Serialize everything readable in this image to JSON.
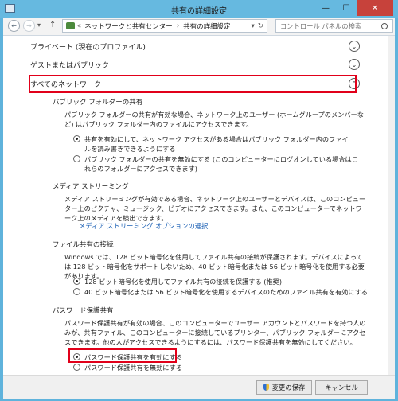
{
  "window": {
    "title": "共有の詳細設定",
    "min_symbol": "—",
    "max_symbol": "☐",
    "close_symbol": "✕"
  },
  "nav": {
    "back": "←",
    "forward": "→",
    "dropdown": "▾",
    "up": "↑",
    "breadcrumb_prefix": "«",
    "breadcrumb_1": "ネットワークと共有センター",
    "sep": "›",
    "breadcrumb_2": "共有の詳細設定",
    "addr_dropdown": "▾",
    "refresh": "↻",
    "search_placeholder": "コントロール パネルの検索"
  },
  "sections": {
    "private": {
      "label": "プライベート (現在のプロファイル)"
    },
    "guest": {
      "label": "ゲストまたはパブリック"
    },
    "all": {
      "label": "すべてのネットワーク"
    }
  },
  "public_folder": {
    "heading": "パブリック フォルダーの共有",
    "desc": "パブリック フォルダーの共有が有効な場合、ネットワーク上のユーザー (ホームグループのメンバーなど) はパブリック フォルダー内のファイルにアクセスできます。",
    "opt_on": "共有を有効にして、ネットワーク アクセスがある場合はパブリック フォルダー内のファイルを読み書きできるようにする",
    "opt_off": "パブリック フォルダーの共有を無効にする (このコンピューターにログオンしている場合はこれらのフォルダーにアクセスできます)"
  },
  "media": {
    "heading": "メディア ストリーミング",
    "desc": "メディア ストリーミングが有効である場合、ネットワーク上のユーザーとデバイスは、このコンピューター上のピクチャ、ミュージック、ビデオにアクセスできます。また、このコンピューターでネットワーク上のメディアを検出できます。",
    "link": "メディア ストリーミング オプションの選択..."
  },
  "file_sharing": {
    "heading": "ファイル共有の接続",
    "desc": "Windows では、128 ビット暗号化を使用してファイル共有の接続が保護されます。デバイスによっては 128 ビット暗号化をサポートしないため、40 ビット暗号化または 56 ビット暗号化を使用する必要があります。",
    "opt_128": "128 ビット暗号化を使用してファイル共有の接続を保護する (推奨)",
    "opt_40": "40 ビット暗号化または 56 ビット暗号化を使用するデバイスのためのファイル共有を有効にする"
  },
  "password": {
    "heading": "パスワード保護共有",
    "desc": "パスワード保護共有が有効の場合、このコンピューターでユーザー アカウントとパスワードを持つ人のみが、共有ファイル、このコンピューターに接続しているプリンター、パブリック フォルダーにアクセスできます。他の人がアクセスできるようにするには、パスワード保護共有を無効にしてください。",
    "opt_on": "パスワード保護共有を有効にする",
    "opt_off": "パスワード保護共有を無効にする"
  },
  "buttons": {
    "save": "変更の保存",
    "cancel": "キャンセル"
  }
}
